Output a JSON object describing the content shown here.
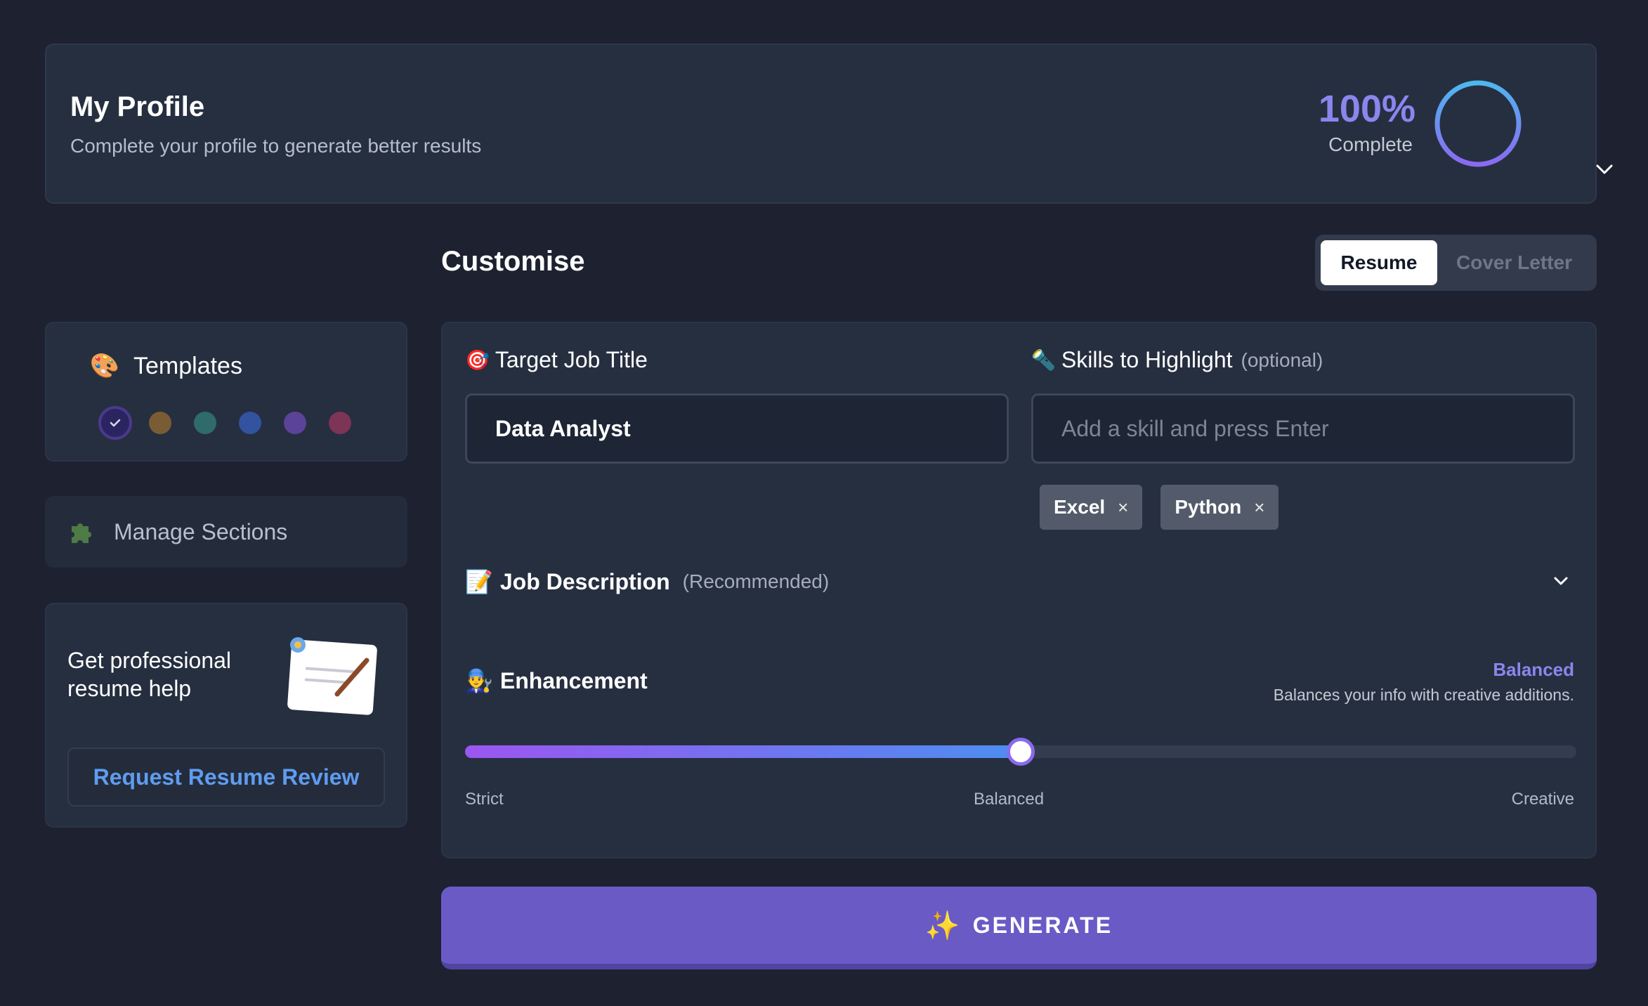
{
  "profile": {
    "title": "My Profile",
    "subtitle": "Complete your profile to generate better results",
    "progress_percent": "100%",
    "progress_value": 100,
    "progress_label": "Complete",
    "ring_colors": [
      "#4fb6f0",
      "#8a6af0"
    ]
  },
  "customise": {
    "title": "Customise",
    "tabs": [
      {
        "label": "Resume",
        "active": true
      },
      {
        "label": "Cover Letter",
        "active": false
      }
    ]
  },
  "templates": {
    "emoji": "🎨",
    "label": "Templates",
    "swatches": [
      {
        "color": "#2a2460",
        "selected": true
      },
      {
        "color": "#7a5c34",
        "selected": false
      },
      {
        "color": "#2f6b6a",
        "selected": false
      },
      {
        "color": "#3352a0",
        "selected": false
      },
      {
        "color": "#5a4399",
        "selected": false
      },
      {
        "color": "#7d3457",
        "selected": false
      }
    ]
  },
  "sections": {
    "label": "Manage Sections",
    "icon": "puzzle-icon"
  },
  "help": {
    "text": "Get professional resume help",
    "button_label": "Request Resume Review"
  },
  "form": {
    "job_title": {
      "emoji": "🎯",
      "label": "Target Job Title",
      "value": "Data Analyst"
    },
    "skills": {
      "emoji": "🔦",
      "label": "Skills to Highlight",
      "optional": "(optional)",
      "placeholder": "Add a skill and press Enter",
      "chips": [
        {
          "label": "Excel",
          "remove": "×"
        },
        {
          "label": "Python",
          "remove": "×"
        }
      ]
    },
    "job_description": {
      "emoji": "📝",
      "label": "Job Description",
      "note": "(Recommended)"
    },
    "enhancement": {
      "emoji": "👨‍🔧",
      "label": "Enhancement",
      "mode": "Balanced",
      "description": "Balances your info with creative additions.",
      "level_fraction": 0.5,
      "scale": [
        "Strict",
        "Balanced",
        "Creative"
      ]
    }
  },
  "generate": {
    "icon": "✨",
    "label": "GENERATE"
  },
  "colors": {
    "background": "#1d2130",
    "card": "#262f40",
    "accent": "#6a5ac6",
    "accent_text": "#8a86ee",
    "link": "#5f9cf0"
  }
}
